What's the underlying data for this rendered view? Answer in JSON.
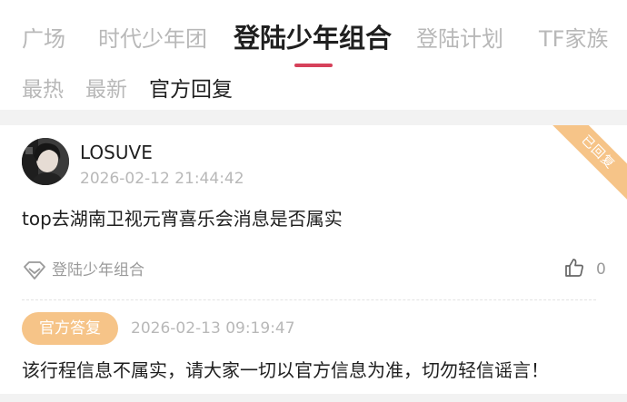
{
  "tabs": [
    {
      "label": "广场"
    },
    {
      "label": "时代少年团"
    },
    {
      "label": "登陆少年组合"
    },
    {
      "label": "登陆计划"
    },
    {
      "label": "TF家族"
    }
  ],
  "active_tab_index": 2,
  "subtabs": [
    {
      "label": "最热"
    },
    {
      "label": "最新"
    },
    {
      "label": "官方回复"
    }
  ],
  "active_subtab_index": 2,
  "post": {
    "ribbon_label": "已回复",
    "username": "LOSUVE",
    "time": "2026-02-12 21:44:42",
    "text": "top去湖南卫视元宵喜乐会消息是否属实",
    "group_tag": "登陆少年组合",
    "like_count": "0",
    "reply": {
      "badge": "官方答复",
      "time": "2026-02-13 09:19:47",
      "text": "该行程信息不属实，请大家一切以官方信息为准，切勿轻信谣言！"
    }
  },
  "colors": {
    "accent": "#d6415a",
    "badge": "#f6c488",
    "muted_text": "#b8b8b8",
    "primary_text": "#1f1f1f",
    "separator": "#f2f2f2"
  },
  "icons": {
    "group_tag": "diamond-icon",
    "like": "thumbs-up-icon"
  }
}
